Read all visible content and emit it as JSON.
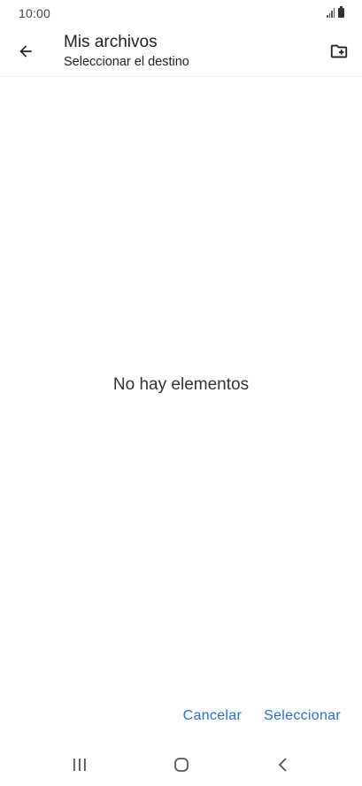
{
  "status_bar": {
    "time": "10:00",
    "signal_icon": "signal-icon",
    "battery_icon": "battery-icon"
  },
  "app_bar": {
    "title": "Mis archivos",
    "subtitle": "Seleccionar el destino",
    "back_icon": "arrow-back-icon",
    "new_folder_icon": "create-new-folder-icon"
  },
  "main": {
    "empty_message": "No hay elementos"
  },
  "actions": {
    "cancel_label": "Cancelar",
    "select_label": "Seleccionar"
  },
  "navigation": {
    "recents_icon": "recents-icon",
    "home_icon": "home-icon",
    "back_icon": "nav-back-icon"
  },
  "colors": {
    "accent": "#2a6fc4",
    "background": "#ffffff",
    "text": "#202124"
  }
}
